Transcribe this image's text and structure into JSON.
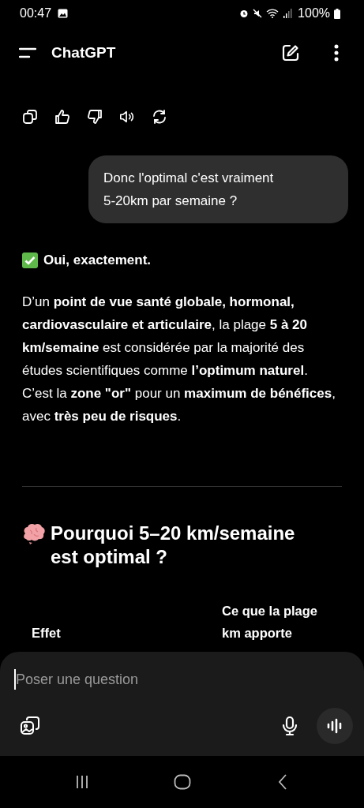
{
  "status_bar": {
    "time": "00:47",
    "battery": "100%"
  },
  "toolbar": {
    "title": "ChatGPT"
  },
  "user_message": {
    "text": "Donc l'optimal c'est vraiment 5-20km par semaine ?"
  },
  "answer": {
    "lead": "Oui, exactement.",
    "paragraph": "D’un **point de vue santé globale, hormonal, cardiovasculaire et articulaire**, la plage **5 à 20 km/semaine** est considérée par la majorité des études scientifiques comme **l’optimum naturel**.",
    "paragraph_2": "C’est la **zone \"or\"** pour un **maximum de bénéfices**, avec **très peu de risques**.",
    "heading": "Pourquoi 5–20 km/semaine est optimal ?",
    "table": {
      "columns": [
        "Effet",
        "Ce que la plage\nkm apporte"
      ]
    }
  },
  "composer": {
    "placeholder": "Poser une question"
  }
}
